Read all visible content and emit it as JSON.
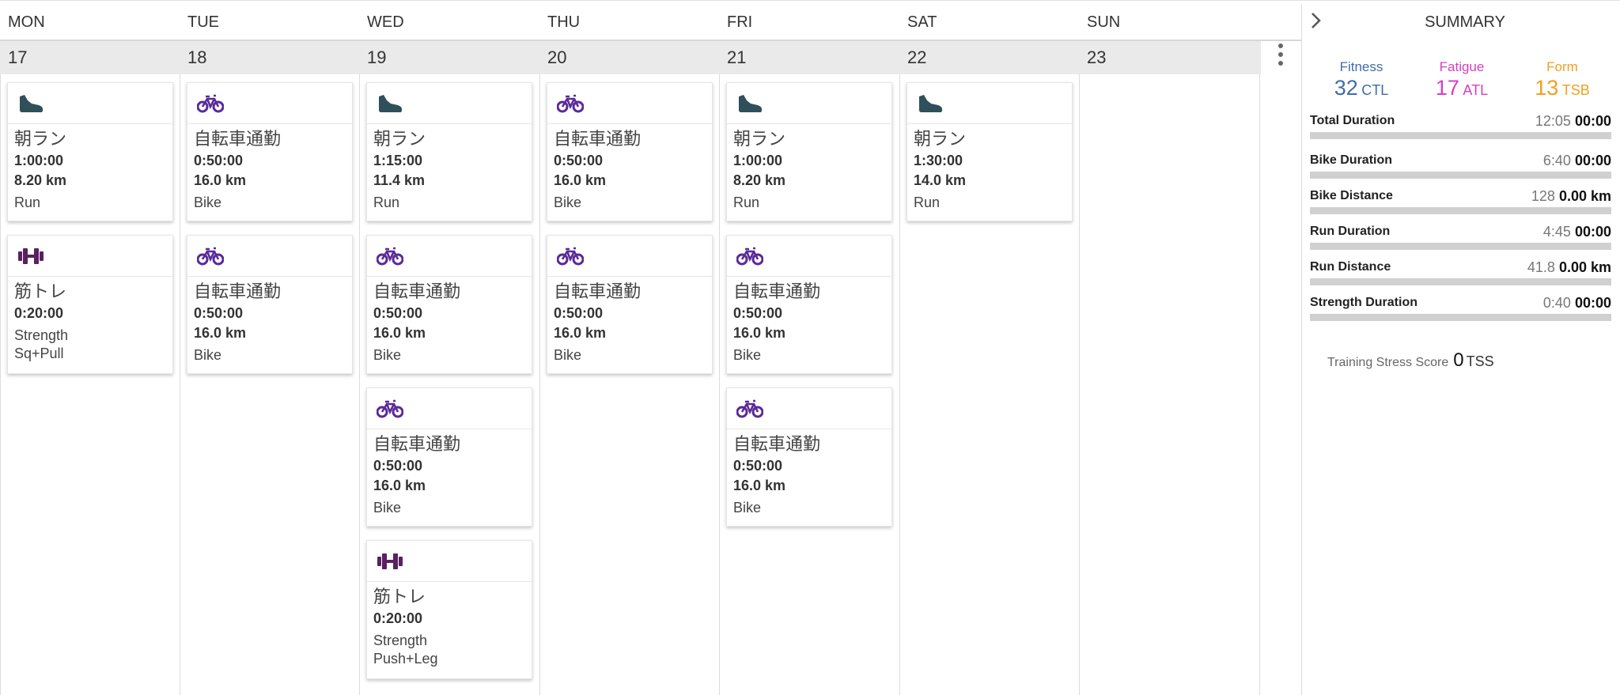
{
  "days": [
    {
      "name": "MON",
      "date": "17"
    },
    {
      "name": "TUE",
      "date": "18"
    },
    {
      "name": "WED",
      "date": "19"
    },
    {
      "name": "THU",
      "date": "20"
    },
    {
      "name": "FRI",
      "date": "21"
    },
    {
      "name": "SAT",
      "date": "22"
    },
    {
      "name": "SUN",
      "date": "23"
    }
  ],
  "workouts": {
    "run_mon": {
      "title": "朝ラン",
      "duration": "1:00:00",
      "distance": "8.20 km",
      "type": "Run"
    },
    "str_mon": {
      "title": "筋トレ",
      "duration": "0:20:00",
      "type": "Strength",
      "desc": "Sq+Pull"
    },
    "bike_tue_1": {
      "title": "自転車通勤",
      "duration": "0:50:00",
      "distance": "16.0 km",
      "type": "Bike"
    },
    "bike_tue_2": {
      "title": "自転車通勤",
      "duration": "0:50:00",
      "distance": "16.0 km",
      "type": "Bike"
    },
    "run_wed": {
      "title": "朝ラン",
      "duration": "1:15:00",
      "distance": "11.4 km",
      "type": "Run"
    },
    "bike_wed_1": {
      "title": "自転車通勤",
      "duration": "0:50:00",
      "distance": "16.0 km",
      "type": "Bike"
    },
    "bike_wed_2": {
      "title": "自転車通勤",
      "duration": "0:50:00",
      "distance": "16.0 km",
      "type": "Bike"
    },
    "str_wed": {
      "title": "筋トレ",
      "duration": "0:20:00",
      "type": "Strength",
      "desc": "Push+Leg"
    },
    "bike_thu_1": {
      "title": "自転車通勤",
      "duration": "0:50:00",
      "distance": "16.0 km",
      "type": "Bike"
    },
    "bike_thu_2": {
      "title": "自転車通勤",
      "duration": "0:50:00",
      "distance": "16.0 km",
      "type": "Bike"
    },
    "run_fri": {
      "title": "朝ラン",
      "duration": "1:00:00",
      "distance": "8.20 km",
      "type": "Run"
    },
    "bike_fri_1": {
      "title": "自転車通勤",
      "duration": "0:50:00",
      "distance": "16.0 km",
      "type": "Bike"
    },
    "bike_fri_2": {
      "title": "自転車通勤",
      "duration": "0:50:00",
      "distance": "16.0 km",
      "type": "Bike"
    },
    "run_sat": {
      "title": "朝ラン",
      "duration": "1:30:00",
      "distance": "14.0 km",
      "type": "Run"
    }
  },
  "icons": {
    "run": "running-shoe-icon",
    "bike": "bicycle-icon",
    "strength": "dumbbell-icon",
    "menu": "vertical-dots-icon",
    "expand": "chevron-right-icon"
  },
  "summary": {
    "title": "SUMMARY",
    "fitness": {
      "label": "Fitness",
      "value": "32",
      "unit": "CTL",
      "color": "#3f6ea8"
    },
    "fatigue": {
      "label": "Fatigue",
      "value": "17",
      "unit": "ATL",
      "color": "#d63fc0"
    },
    "form": {
      "label": "Form",
      "value": "13",
      "unit": "TSB",
      "color": "#f0a020"
    },
    "rows": [
      {
        "label": "Total Duration",
        "actual": "12:05",
        "planned": "00:00"
      },
      {
        "label": "Bike Duration",
        "actual": "6:40",
        "planned": "00:00"
      },
      {
        "label": "Bike Distance",
        "actual": "128",
        "planned": "0.00 km"
      },
      {
        "label": "Run Duration",
        "actual": "4:45",
        "planned": "00:00"
      },
      {
        "label": "Run Distance",
        "actual": "41.8",
        "planned": "0.00 km"
      },
      {
        "label": "Strength Duration",
        "actual": "0:40",
        "planned": "00:00"
      }
    ],
    "tss": {
      "label": "Training Stress Score",
      "value": "0",
      "unit": "TSS"
    }
  },
  "colors": {
    "run_icon": "#2f4f5a",
    "bike_icon": "#5b2a9a",
    "strength_icon": "#5a2060"
  }
}
